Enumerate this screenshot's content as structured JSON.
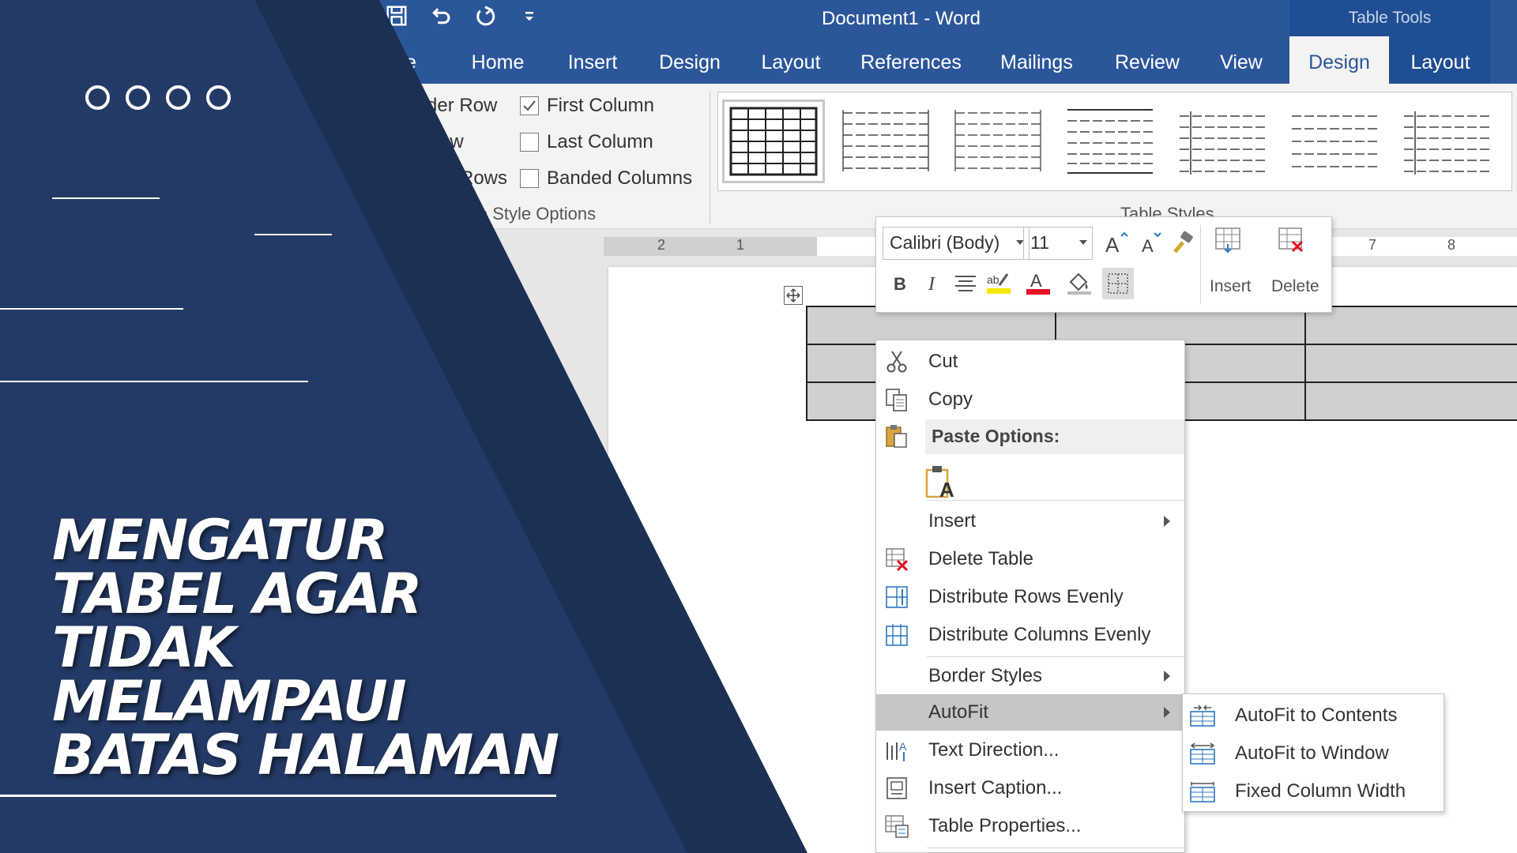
{
  "app": {
    "document_title": "Document1 - Word",
    "table_tools_label": "Table Tools"
  },
  "tabs": [
    {
      "label": "e"
    },
    {
      "label": "Home"
    },
    {
      "label": "Insert"
    },
    {
      "label": "Design"
    },
    {
      "label": "Layout"
    },
    {
      "label": "References"
    },
    {
      "label": "Mailings"
    },
    {
      "label": "Review"
    },
    {
      "label": "View"
    },
    {
      "label": "Design",
      "active": true
    },
    {
      "label": "Layout"
    }
  ],
  "ribbon": {
    "header_row": "der Row",
    "total_row": "ow",
    "banded_rows": "Rows",
    "first_column": "First Column",
    "last_column": "Last Column",
    "banded_columns": "Banded Columns",
    "group_style_options": "le Style Options",
    "group_table_styles": "Table Styles"
  },
  "ruler": {
    "labels": [
      "2",
      "1",
      "7",
      "8"
    ]
  },
  "minibar": {
    "font_name": "Calibri (Body)",
    "font_size": "11",
    "insert_label": "Insert",
    "delete_label": "Delete"
  },
  "context_menu": {
    "cut": "Cut",
    "copy": "Copy",
    "paste_options": "Paste Options:",
    "insert": "Insert",
    "delete_table": "Delete Table",
    "distribute_rows": "Distribute Rows Evenly",
    "distribute_columns": "Distribute Columns Evenly",
    "border_styles": "Border Styles",
    "autofit": "AutoFit",
    "text_direction": "Text Direction...",
    "insert_caption": "Insert Caption...",
    "table_properties": "Table Properties..."
  },
  "autofit_submenu": {
    "to_contents": "AutoFit to Contents",
    "to_window": "AutoFit to Window",
    "fixed_width": "Fixed Column Width"
  },
  "banner": {
    "headline": [
      "MENGATUR",
      "TABEL AGAR",
      "TIDAK",
      "MELAMPAUI",
      "BATAS HALAMAN"
    ]
  },
  "colors": {
    "word_blue": "#2b579a",
    "banner_navy": "#243a66",
    "banner_dark": "#1c2f55",
    "menu_highlight": "#c6c6c6"
  },
  "icons": [
    "save-icon",
    "undo-icon",
    "redo-icon",
    "customize-qat-icon",
    "checkbox-checked-icon",
    "checkbox-empty-icon",
    "table-move-handle-icon",
    "grow-font-icon",
    "shrink-font-icon",
    "format-painter-icon",
    "bold-icon",
    "italic-icon",
    "center-align-icon",
    "highlight-icon",
    "font-color-icon",
    "shading-icon",
    "borders-icon",
    "insert-table-icon",
    "delete-table-icon",
    "scissors-icon",
    "copy-icon",
    "paste-icon",
    "paste-keep-text-icon",
    "distribute-rows-icon",
    "distribute-columns-icon",
    "text-direction-icon",
    "caption-icon",
    "table-properties-icon",
    "autofit-contents-icon",
    "autofit-window-icon",
    "fixed-width-icon"
  ]
}
